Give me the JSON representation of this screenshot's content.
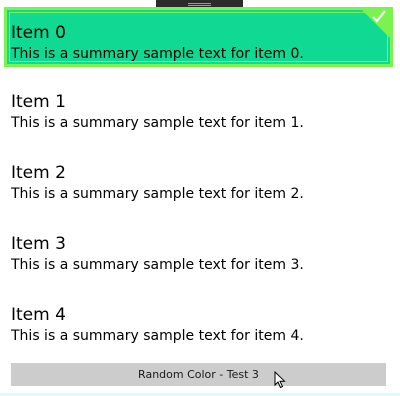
{
  "items": [
    {
      "title": "Item 0",
      "summary": "This is a summary sample text for item 0.",
      "selected": true
    },
    {
      "title": "Item 1",
      "summary": "This is a summary sample text for item 1.",
      "selected": false
    },
    {
      "title": "Item 2",
      "summary": "This is a summary sample text for item 2.",
      "selected": false
    },
    {
      "title": "Item 3",
      "summary": "This is a summary sample text for item 3.",
      "selected": false
    },
    {
      "title": "Item 4",
      "summary": "This is a summary sample text for item 4.",
      "selected": false
    }
  ],
  "button": {
    "label": "Random Color - Test 3"
  },
  "icons": {
    "selected_marker": "checkmark-icon",
    "pointer": "mouse-pointer-icon",
    "handle": "drag-handle"
  },
  "colors": {
    "selected_background": "#10d994",
    "selected_border": "#7cf24e",
    "button_background": "#cccccc",
    "handle_background": "#2b2b2b"
  }
}
